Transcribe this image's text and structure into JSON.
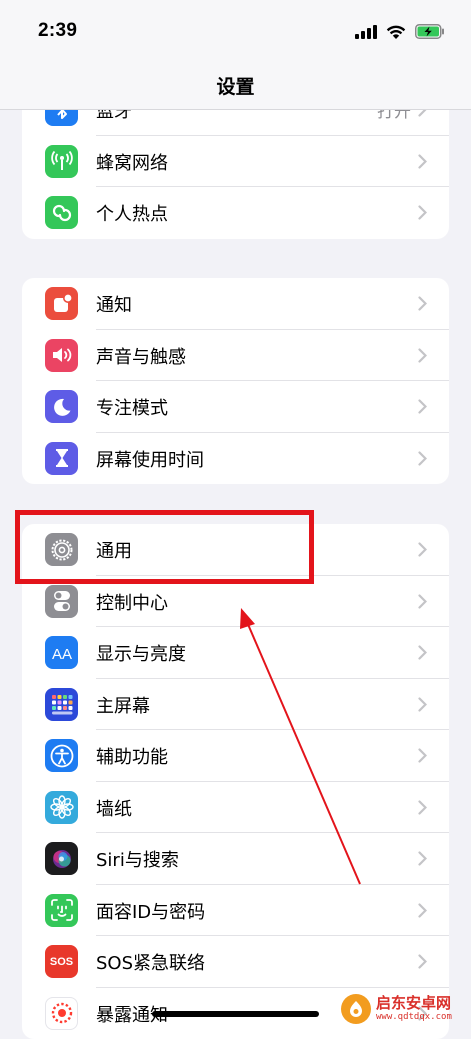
{
  "status_bar": {
    "time": "2:39"
  },
  "nav": {
    "title": "设置"
  },
  "group1": [
    {
      "label": "蓝牙",
      "value": "打开",
      "icon": "bluetooth-icon",
      "color": "#1e7cf2"
    },
    {
      "label": "蜂窝网络",
      "icon": "antenna-icon",
      "color": "#34c759"
    },
    {
      "label": "个人热点",
      "icon": "hotspot-icon",
      "color": "#34c759"
    }
  ],
  "group2": [
    {
      "label": "通知",
      "icon": "notification-bell-icon",
      "color": "#eb4d3d"
    },
    {
      "label": "声音与触感",
      "icon": "speaker-icon",
      "color": "#eb4463"
    },
    {
      "label": "专注模式",
      "icon": "moon-icon",
      "color": "#5e5ce6"
    },
    {
      "label": "屏幕使用时间",
      "icon": "hourglass-icon",
      "color": "#5e5ce6"
    }
  ],
  "group3": [
    {
      "label": "通用",
      "icon": "gear-icon",
      "color": "#8e8e93"
    },
    {
      "label": "控制中心",
      "icon": "toggles-icon",
      "color": "#8e8e93"
    },
    {
      "label": "显示与亮度",
      "icon": "text-size-icon",
      "color": "#1e7cf2"
    },
    {
      "label": "主屏幕",
      "icon": "home-screen-grid-icon",
      "color": "#2c49d9"
    },
    {
      "label": "辅助功能",
      "icon": "accessibility-icon",
      "color": "#1e7cf2"
    },
    {
      "label": "墙纸",
      "icon": "flower-icon",
      "color": "#34aadc"
    },
    {
      "label": "Siri与搜索",
      "icon": "siri-icon",
      "color": "#1c1c1e"
    },
    {
      "label": "面容ID与密码",
      "icon": "face-id-icon",
      "color": "#34c759"
    },
    {
      "label": "SOS紧急联络",
      "icon": "sos-icon",
      "color": "#e8382b",
      "icon_text": "SOS"
    },
    {
      "label": "暴露通知",
      "icon": "exposure-icon",
      "color": "#ffffff"
    }
  ],
  "watermark": {
    "title": "启东安卓网",
    "url": "www.qdtdqx.com"
  }
}
